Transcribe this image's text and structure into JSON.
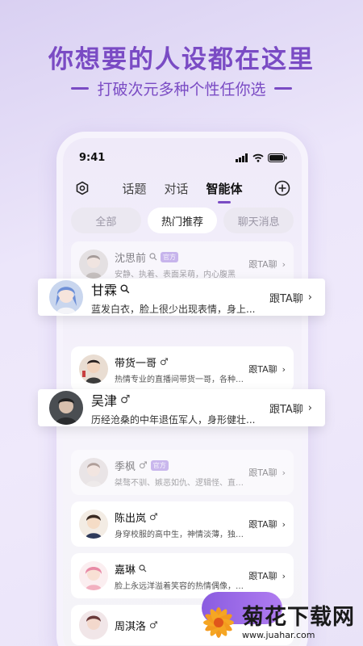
{
  "hero": {
    "title": "你想要的人设都在这里",
    "subtitle": "打破次元多种个性任你选"
  },
  "status_bar": {
    "time": "9:41"
  },
  "nav": {
    "tabs": [
      {
        "label": "话题",
        "active": false
      },
      {
        "label": "对话",
        "active": false
      },
      {
        "label": "智能体",
        "active": true
      }
    ]
  },
  "filters": [
    {
      "label": "全部",
      "active": false
    },
    {
      "label": "热门推荐",
      "active": true
    },
    {
      "label": "聊天消息",
      "active": false
    }
  ],
  "follow_label": "跟TA聊",
  "official_badge": "官方",
  "characters": [
    {
      "name": "沈思前",
      "desc": "安静、执着、表面呆萌，内心腹黑",
      "marker": "search-icon",
      "official": true
    },
    {
      "name": "甘霖",
      "desc": "蓝发白衣，脸上很少出现表情，身上...",
      "marker": "search-icon",
      "official": false
    },
    {
      "name": "带货一哥",
      "desc": "热情专业的直播间带货一哥，各种产...",
      "marker": "♂",
      "official": false
    },
    {
      "name": "吴津",
      "desc": "历经沧桑的中年退伍军人，身形健壮...",
      "marker": "♂",
      "official": false
    },
    {
      "name": "季枫",
      "desc": "桀骜不驯、嫉恶如仇、逻辑怪、直言...",
      "marker": "♂",
      "official": true
    },
    {
      "name": "陈出岚",
      "desc": "身穿校服的高中生，神情淡薄，独来...",
      "marker": "♂",
      "official": false
    },
    {
      "name": "嘉琳",
      "desc": "脸上永远洋溢着笑容的热情偶像，喜...",
      "marker": "search-icon",
      "official": false
    },
    {
      "name": "周淇洛",
      "desc": "",
      "marker": "♂",
      "official": false
    }
  ],
  "watermark": {
    "title": "菊花下载网",
    "url": "www.juahar.com"
  },
  "colors": {
    "accent": "#7a4bc4",
    "badge": "#9d7be0"
  }
}
